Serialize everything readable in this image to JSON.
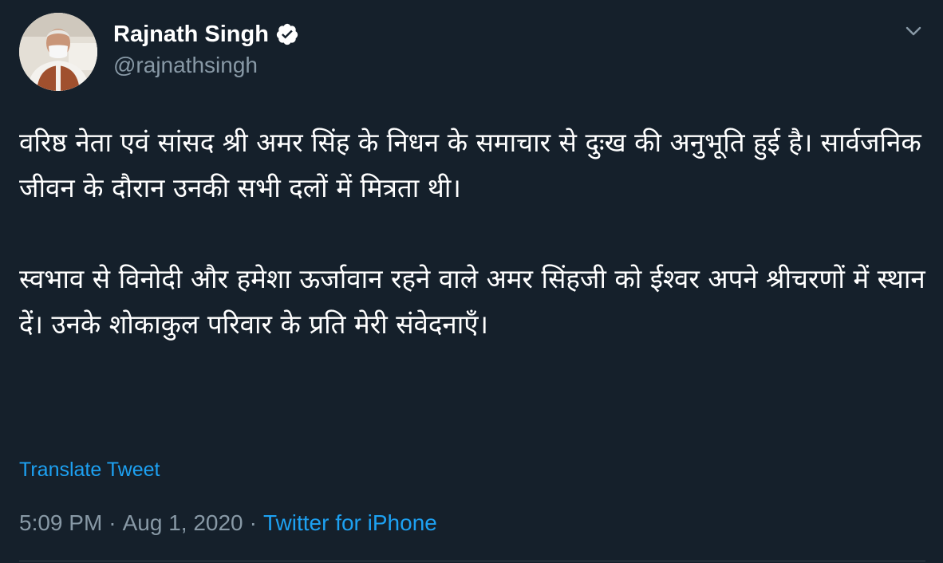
{
  "tweet": {
    "author": {
      "name": "Rajnath Singh",
      "handle": "@rajnathsingh",
      "verified": true,
      "avatar_icon": "profile-photo"
    },
    "text": {
      "paragraph1": "वरिष्ठ नेता एवं सांसद श्री अमर सिंह के निधन के समाचार से दुःख की अनुभूति हुई है। सार्वजनिक जीवन के दौरान उनकी सभी दलों में मित्रता थी।",
      "paragraph2": "स्वभाव से विनोदी और हमेशा ऊर्जावान रहने वाले अमर सिंहजी को ईश्वर अपने श्रीचरणों में स्थान दें। उनके शोकाकुल परिवार के प्रति मेरी संवेदनाएँ।"
    },
    "translate_label": "Translate Tweet",
    "time": "5:09 PM",
    "separator": "·",
    "date": "Aug 1, 2020",
    "source": "Twitter for iPhone"
  },
  "colors": {
    "background": "#15202b",
    "text": "#ffffff",
    "secondary": "#8899a6",
    "accent": "#1da1f2",
    "divider": "#38444d"
  }
}
